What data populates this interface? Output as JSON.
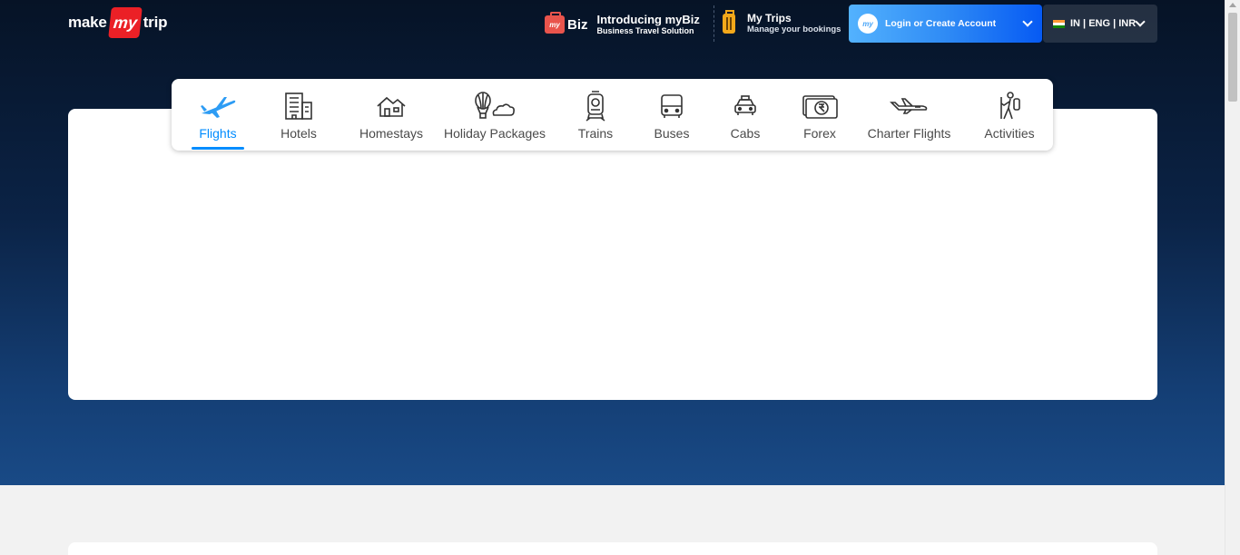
{
  "brand": {
    "make": "make",
    "my": "my",
    "trip": "trip"
  },
  "header": {
    "mybiz": {
      "badge": "my",
      "word": "Biz",
      "title": "Introducing myBiz",
      "subtitle": "Business Travel Solution"
    },
    "my_trips": {
      "title": "My Trips",
      "subtitle": "Manage your bookings"
    },
    "login": {
      "avatar": "my",
      "label": "Login or Create Account"
    },
    "locale": {
      "label": "IN | ENG | INR",
      "flag": "india-flag"
    }
  },
  "nav": {
    "active": "Flights",
    "items": [
      {
        "label": "Flights",
        "icon": "airplane-icon"
      },
      {
        "label": "Hotels",
        "icon": "hotel-building-icon"
      },
      {
        "label": "Homestays",
        "icon": "house-icon"
      },
      {
        "label": "Holiday Packages",
        "icon": "balloon-cloud-icon"
      },
      {
        "label": "Trains",
        "icon": "train-icon"
      },
      {
        "label": "Buses",
        "icon": "bus-icon"
      },
      {
        "label": "Cabs",
        "icon": "taxi-icon"
      },
      {
        "label": "Forex",
        "icon": "rupee-note-icon"
      },
      {
        "label": "Charter Flights",
        "icon": "private-jet-icon"
      },
      {
        "label": "Activities",
        "icon": "hiker-icon"
      }
    ]
  },
  "colors": {
    "accent": "#008cff",
    "brand_red": "#eb2026",
    "hero_top": "#061326",
    "hero_bottom": "#194a86",
    "login_gradient_start": "#53b2fe",
    "login_gradient_end": "#065af3"
  }
}
